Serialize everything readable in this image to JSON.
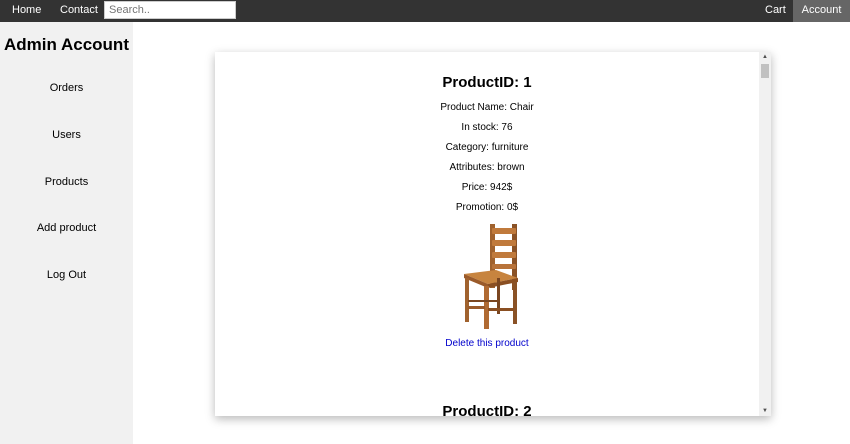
{
  "nav": {
    "home": "Home",
    "contact": "Contact",
    "search_placeholder": "Search..",
    "cart": "Cart",
    "account": "Account"
  },
  "sidebar": {
    "title": "Admin Account",
    "items": [
      {
        "label": "Orders"
      },
      {
        "label": "Users"
      },
      {
        "label": "Products"
      },
      {
        "label": "Add product"
      },
      {
        "label": "Log Out"
      }
    ]
  },
  "products": [
    {
      "heading": "ProductID: 1",
      "name": "Product Name: Chair",
      "stock": "In stock: 76",
      "category": "Category: furniture",
      "attributes": "Attributes: brown",
      "price": "Price: 942$",
      "promotion": "Promotion: 0$",
      "image_icon": "wooden-chair",
      "delete_label": "Delete this product"
    },
    {
      "heading": "ProductID: 2"
    }
  ],
  "colors": {
    "nav_bg": "#333333",
    "nav_active_bg": "#666666",
    "sidebar_bg": "#f1f1f1",
    "link_blue": "#0000cc"
  }
}
